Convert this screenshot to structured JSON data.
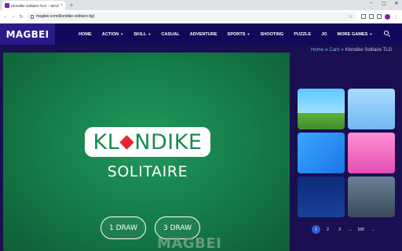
{
  "browser": {
    "tab_title": "Klondike Solitaire TLG – MAGBEI",
    "tab_close": "×",
    "new_tab": "+",
    "url": "magbei.com/klondike-solitaire-tlg/",
    "window_controls": [
      "–",
      "▢",
      "✕"
    ]
  },
  "header": {
    "logo": "MAGBEI",
    "nav": [
      {
        "label": "HOME",
        "dropdown": false
      },
      {
        "label": "ACTION",
        "dropdown": true
      },
      {
        "label": "SKILL",
        "dropdown": true
      },
      {
        "label": "CASUAL",
        "dropdown": false
      },
      {
        "label": "ADVENTURE",
        "dropdown": false
      },
      {
        "label": "SPORTS",
        "dropdown": true
      },
      {
        "label": "SHOOTING",
        "dropdown": false
      },
      {
        "label": "PUZZLE",
        "dropdown": false
      },
      {
        "label": "JO",
        "dropdown": false
      },
      {
        "label": "MORE GAMES",
        "dropdown": true
      }
    ],
    "icons": [
      "search-icon"
    ]
  },
  "breadcrumb": {
    "home": "Home",
    "sep1": "»",
    "card": "Card",
    "sep2": "»",
    "current": "Klondike Solitaire TLG"
  },
  "game": {
    "title_left": "KL",
    "title_right": "NDIKE",
    "subtitle": "SOLITAIRE",
    "buttons": {
      "one_draw": "1 DRAW",
      "three_draw": "3 DRAW"
    },
    "watermark": "MAGBEI"
  },
  "sidebar": {
    "thumbnails": [
      {
        "alt": "game-thumbnail-1"
      },
      {
        "alt": "game-thumbnail-2"
      },
      {
        "alt": "game-thumbnail-3"
      },
      {
        "alt": "game-thumbnail-4"
      },
      {
        "alt": "game-thumbnail-5"
      },
      {
        "alt": "game-thumbnail-6"
      }
    ],
    "pagination": {
      "pages": [
        "1",
        "2",
        "3",
        "...",
        "100"
      ],
      "active": "1",
      "next": "→"
    }
  },
  "colors": {
    "header_bg": "#13095a",
    "page_bg": "#1a0f50",
    "game_green": "#1b8a52",
    "diamond_red": "#e8223a",
    "link_blue": "#6fb0ff"
  }
}
